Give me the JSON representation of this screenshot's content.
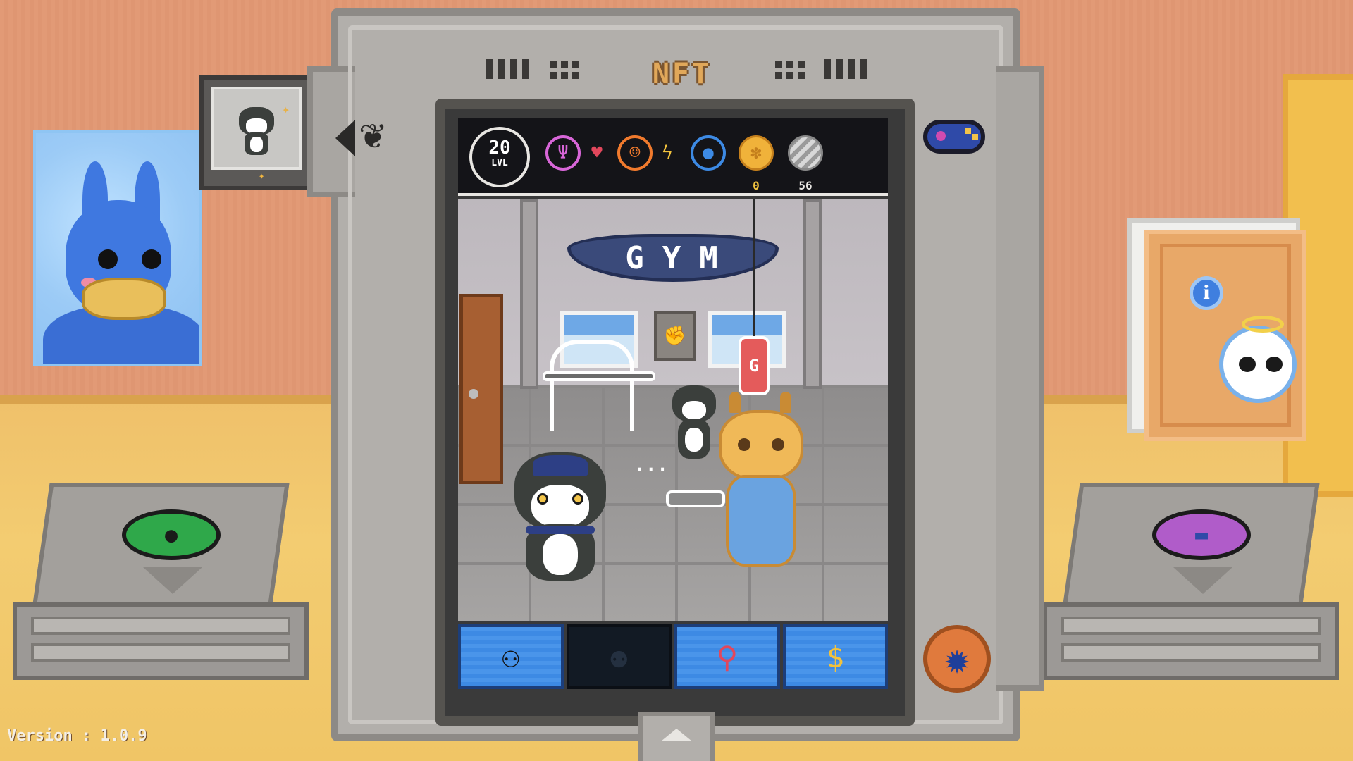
{
  "app": {
    "brand_title": "NFT",
    "version_text": "Version : 1.0.9"
  },
  "hud": {
    "level_number": "20",
    "level_label": "LVL",
    "stats": [
      {
        "name": "hunger",
        "icon": "fork-cup-icon",
        "color": "#d866d8"
      },
      {
        "name": "love",
        "icon": "heart-icon",
        "color": "#e2475c"
      },
      {
        "name": "happiness",
        "icon": "smile-face-icon",
        "color": "#f07a2d"
      },
      {
        "name": "energy",
        "icon": "lightning-icon",
        "color": "#f2c23d"
      },
      {
        "name": "hygiene",
        "icon": "water-drop-icon",
        "color": "#3d8ae4"
      }
    ],
    "gold_coins": "0",
    "silver_coins": "56"
  },
  "scene": {
    "banner_text": "GYM",
    "punching_bag_letter": "G"
  },
  "tabs": [
    {
      "name": "pet-tree-tab",
      "icon": "pet-tree-icon",
      "active": true
    },
    {
      "name": "friends-tab",
      "icon": "people-icon",
      "active": false
    },
    {
      "name": "map-tab",
      "icon": "map-pin-icon",
      "active": true
    },
    {
      "name": "coins-tab",
      "icon": "coin-stack-icon",
      "active": true
    }
  ],
  "colors": {
    "accent_blue": "#3d8ae4",
    "console_gray": "#b2afab",
    "gold": "#f0c23f",
    "paw_pad_green": "#2fa84a",
    "gamepad_pad_magenta": "#b05cc9"
  }
}
